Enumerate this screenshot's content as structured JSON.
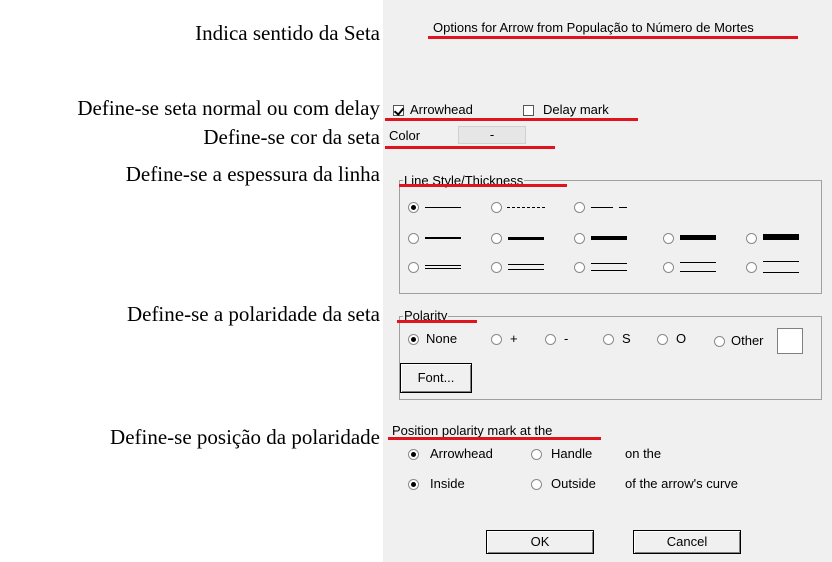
{
  "annotations": {
    "arrow_direction": "Indica sentido da Seta",
    "normal_or_delay": "Define-se seta normal ou com delay",
    "arrow_color": "Define-se cor da seta",
    "line_thickness": "Define-se a espessura da  linha",
    "polarity": "Define-se a polaridade da seta",
    "polarity_position": "Define-se posição da polaridade"
  },
  "dialog": {
    "title": "Options for Arrow from População to Número de Mortes",
    "arrowhead_label": "Arrowhead",
    "arrowhead_checked": true,
    "delay_mark_label": "Delay mark",
    "delay_mark_checked": false,
    "color_label": "Color",
    "color_value": "-",
    "line_style_legend": "Line Style/Thickness",
    "polarity_legend": "Polarity",
    "polarity_options": [
      "None",
      "+",
      "-",
      "S",
      "O",
      "Other"
    ],
    "polarity_selected": "None",
    "font_button": "Font...",
    "position_legend": "Position polarity mark at the",
    "pos_arrowhead": "Arrowhead",
    "pos_handle": "Handle",
    "pos_on_the": "on the",
    "pos_inside": "Inside",
    "pos_outside": "Outside",
    "pos_curve": "of the arrow's curve",
    "ok_button": "OK",
    "cancel_button": "Cancel"
  },
  "colors": {
    "highlight": "#e0141e",
    "dialog_bg": "#f0f0f0"
  }
}
